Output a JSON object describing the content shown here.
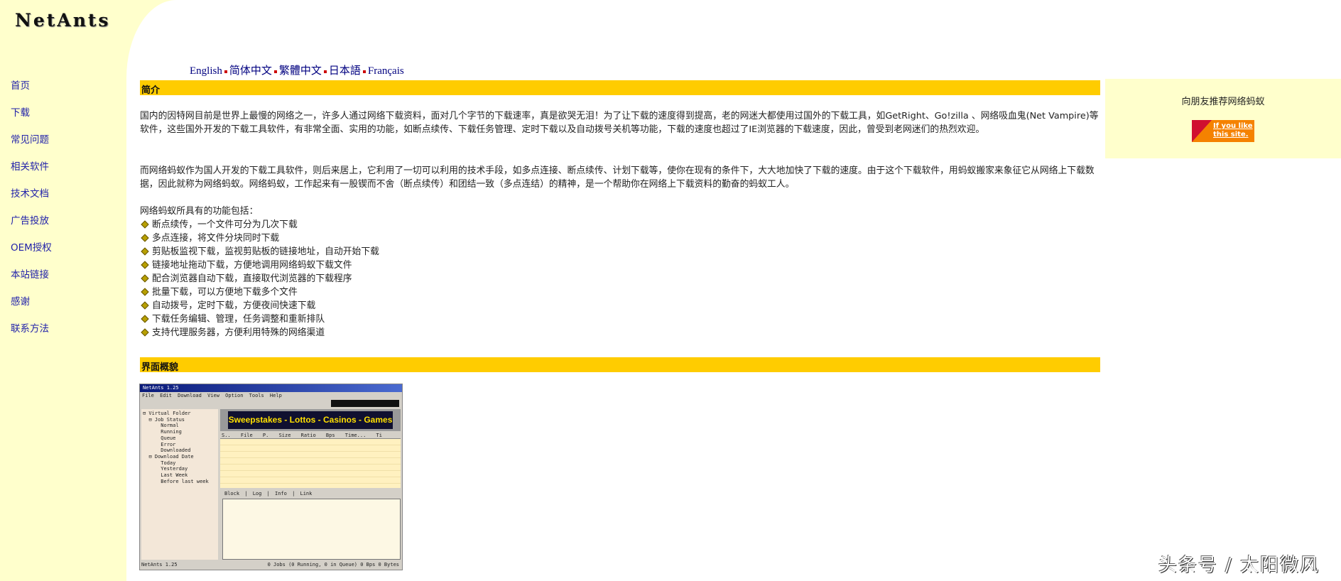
{
  "logo": "NetAnts",
  "nav": [
    "首页",
    "下载",
    "常见问题",
    "相关软件",
    "技术文档",
    "广告投放",
    "OEM授权",
    "本站链接",
    "感谢",
    "联系方法"
  ],
  "languages": [
    "English",
    "简体中文",
    "繁體中文",
    "日本語",
    "Français"
  ],
  "sections": {
    "intro": "简介",
    "interface": "界面概貌"
  },
  "intro_paragraphs": [
    "国内的因特网目前是世界上最慢的网络之一，许多人通过网络下载资料，面对几个字节的下载速率，真是欲哭无泪！为了让下载的速度得到提高，老的网迷大都使用过国外的下载工具，如GetRight、Go!zilla 、网络吸血鬼(Net Vampire)等软件，这些国外开发的下载工具软件，有非常全面、实用的功能，如断点续传、下载任务管理、定时下载以及自动拨号关机等功能，下载的速度也超过了IE浏览器的下载速度，因此，曾受到老网迷们的热烈欢迎。",
    "而网络蚂蚁作为国人开发的下载工具软件，则后来居上，它利用了一切可以利用的技术手段，如多点连接、断点续传、计划下载等，使你在现有的条件下，大大地加快了下载的速度。由于这个下载软件，用蚂蚁搬家来象征它从网络上下载数据，因此就称为网络蚂蚁。网络蚂蚁，工作起来有一股锲而不舍（断点续传）和团结一致（多点连结）的精神，是一个帮助你在网络上下载资料的勤奋的蚂蚁工人。"
  ],
  "features_title": "网络蚂蚁所具有的功能包括：",
  "features": [
    "断点续传，一个文件可分为几次下载",
    "多点连接，将文件分块同时下载",
    "剪贴板监视下载，监视剪贴板的链接地址，自动开始下载",
    "链接地址拖动下载，方便地调用网络蚂蚁下载文件",
    "配合浏览器自动下载，直接取代浏览器的下载程序",
    "批量下载，可以方便地下载多个文件",
    "自动拨号，定时下载，方便夜间快速下载",
    "下载任务编辑、管理，任务调整和重新排队",
    "支持代理服务器，方便利用特殊的网络渠道"
  ],
  "side": {
    "recommend": "向朋友推荐网络蚂蚁",
    "badge": "If you like this site."
  },
  "app": {
    "title": "NetAnts 1.25",
    "menu": "File Edit Download View Option Tools Help",
    "tree": [
      "⊟ Virtual Folder",
      "  ⊟ Job Status",
      "      Normal",
      "      Running",
      "      Queue",
      "      Error",
      "      Downloaded",
      "  ⊟ Download Date",
      "      Today",
      "      Yesterday",
      "      Last Week",
      "      Before last week"
    ],
    "banner": "Sweepstakes - Lottos - Casinos - Games",
    "columns": "S.. File P. Size Ratio Bps Time... Ti",
    "tabs": "Block | Log | Info | Link",
    "status_left": "NetAnts 1.25",
    "status_right": "0 Jobs (0 Running, 0 in Queue) 0 Bps  0 Bytes"
  },
  "watermark": "头条号 / 太阳微风"
}
